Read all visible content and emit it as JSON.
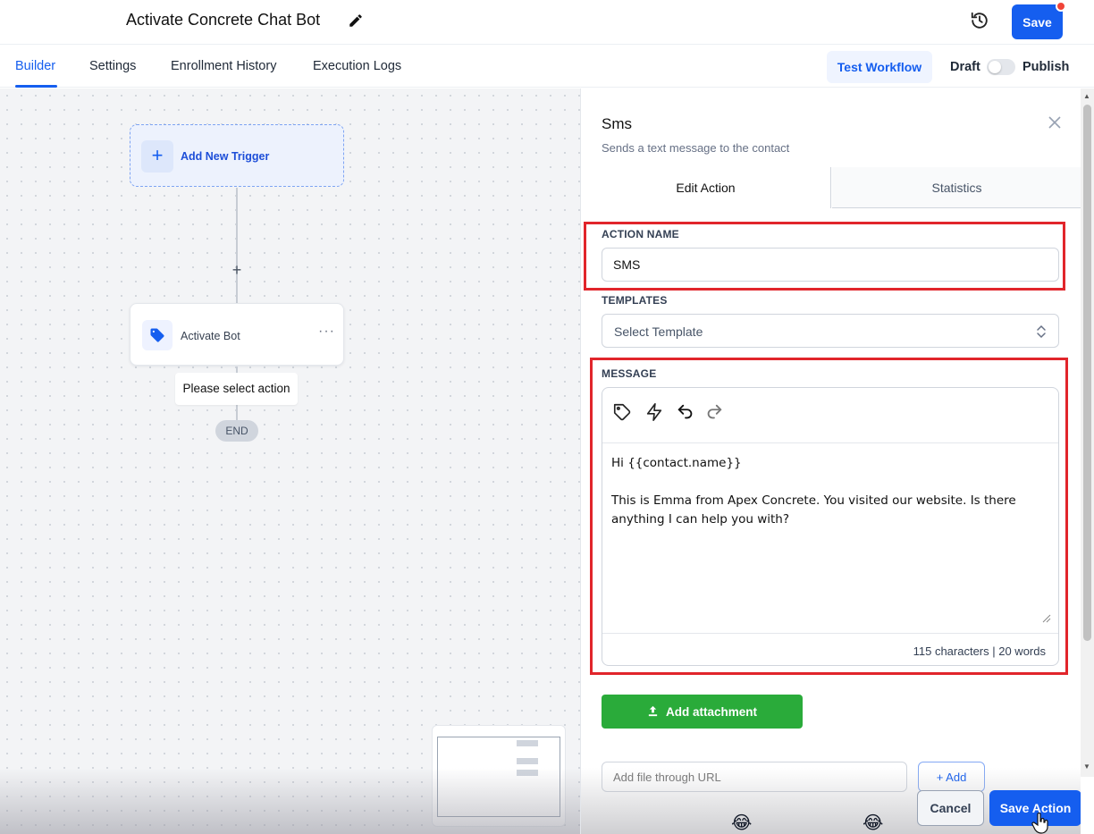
{
  "header": {
    "workflow_title": "Activate Concrete Chat Bot",
    "save_label": "Save",
    "accent_color": "#155eef"
  },
  "tabs": {
    "items": [
      {
        "label": "Builder",
        "active": true
      },
      {
        "label": "Settings",
        "active": false
      },
      {
        "label": "Enrollment History",
        "active": false
      },
      {
        "label": "Execution Logs",
        "active": false
      }
    ],
    "test_workflow_label": "Test Workflow",
    "draft_label": "Draft",
    "publish_label": "Publish",
    "published": false
  },
  "canvas": {
    "add_trigger_label": "Add New Trigger",
    "add_trigger_icon": "plus-icon",
    "action_node_label": "Activate Bot",
    "action_node_icon": "tag-icon",
    "action_menu_icon": "more-horizontal-icon",
    "select_action_hint": "Please select action",
    "end_label": "END"
  },
  "panel": {
    "title": "Sms",
    "subtitle": "Sends a text message to the contact",
    "tabs": [
      {
        "label": "Edit Action",
        "active": true
      },
      {
        "label": "Statistics",
        "active": false
      }
    ],
    "action_name_label": "ACTION NAME",
    "action_name_value": "SMS",
    "templates_label": "TEMPLATES",
    "template_selected": "Select Template",
    "message_label": "MESSAGE",
    "message_lines": [
      "Hi {{contact.name}}",
      "",
      "This is Emma from Apex Concrete. You visited our website. Is there anything I can help you with?"
    ],
    "toolbar_icons": [
      "tag-icon",
      "lightning-icon",
      "undo-icon",
      "redo-icon"
    ],
    "counter_text": "115 characters | 20 words",
    "add_attachment_label": "Add attachment",
    "file_input_placeholder": "Add file through URL",
    "add_url_label": "+ Add",
    "cancel_label": "Cancel",
    "save_action_label": "Save Action",
    "attachment_color": "#2aab3a",
    "highlight_color": "#e1252b"
  },
  "overlay": {
    "emoji_1": "😂",
    "emoji_2": "😂"
  }
}
